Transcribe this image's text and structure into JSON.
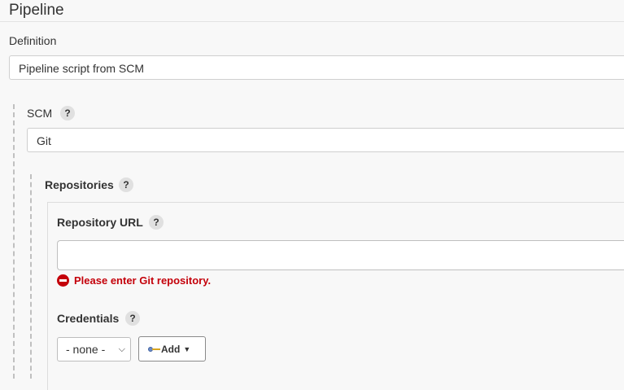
{
  "pipeline": {
    "title": "Pipeline",
    "definition_label": "Definition",
    "definition_value": "Pipeline script from SCM"
  },
  "scm": {
    "label": "SCM",
    "help": "?",
    "value": "Git"
  },
  "repositories": {
    "label": "Repositories",
    "help": "?",
    "url_label": "Repository URL",
    "url_help": "?",
    "url_value": "",
    "error": "Please enter Git repository.",
    "credentials_label": "Credentials",
    "credentials_help": "?",
    "credentials_value": "- none -",
    "add_button": "Add"
  },
  "colors": {
    "error": "#c4000a",
    "background": "#f8f8f8"
  },
  "icons": [
    "help-icon",
    "error-icon",
    "key-icon",
    "caret-down-icon"
  ]
}
